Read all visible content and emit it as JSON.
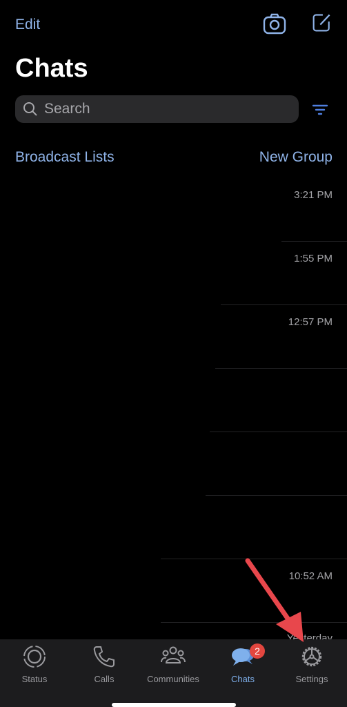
{
  "header": {
    "edit_label": "Edit",
    "camera_icon": "camera-icon",
    "compose_icon": "compose-icon",
    "title": "Chats"
  },
  "search": {
    "placeholder": "Search",
    "value": "",
    "filter_icon": "filter-icon"
  },
  "links": {
    "broadcast_lists": "Broadcast Lists",
    "new_group": "New Group"
  },
  "chats": [
    {
      "time": "3:21 PM"
    },
    {
      "time": "1:55 PM"
    },
    {
      "time": "12:57 PM"
    },
    {
      "time": ""
    },
    {
      "time": ""
    },
    {
      "time": ""
    },
    {
      "time": "10:52 AM"
    },
    {
      "time": "Yesterday"
    }
  ],
  "tabbar": {
    "tabs": [
      {
        "label": "Status",
        "icon": "status-icon"
      },
      {
        "label": "Calls",
        "icon": "phone-icon"
      },
      {
        "label": "Communities",
        "icon": "communities-icon"
      },
      {
        "label": "Chats",
        "icon": "chat-bubbles-icon",
        "badge": "2",
        "active": true
      },
      {
        "label": "Settings",
        "icon": "gear-icon"
      }
    ]
  },
  "colors": {
    "accent": "#8fb3e8",
    "active_tab": "#7fb0ec",
    "badge": "#e2463f",
    "annotation_arrow": "#e8474c"
  }
}
